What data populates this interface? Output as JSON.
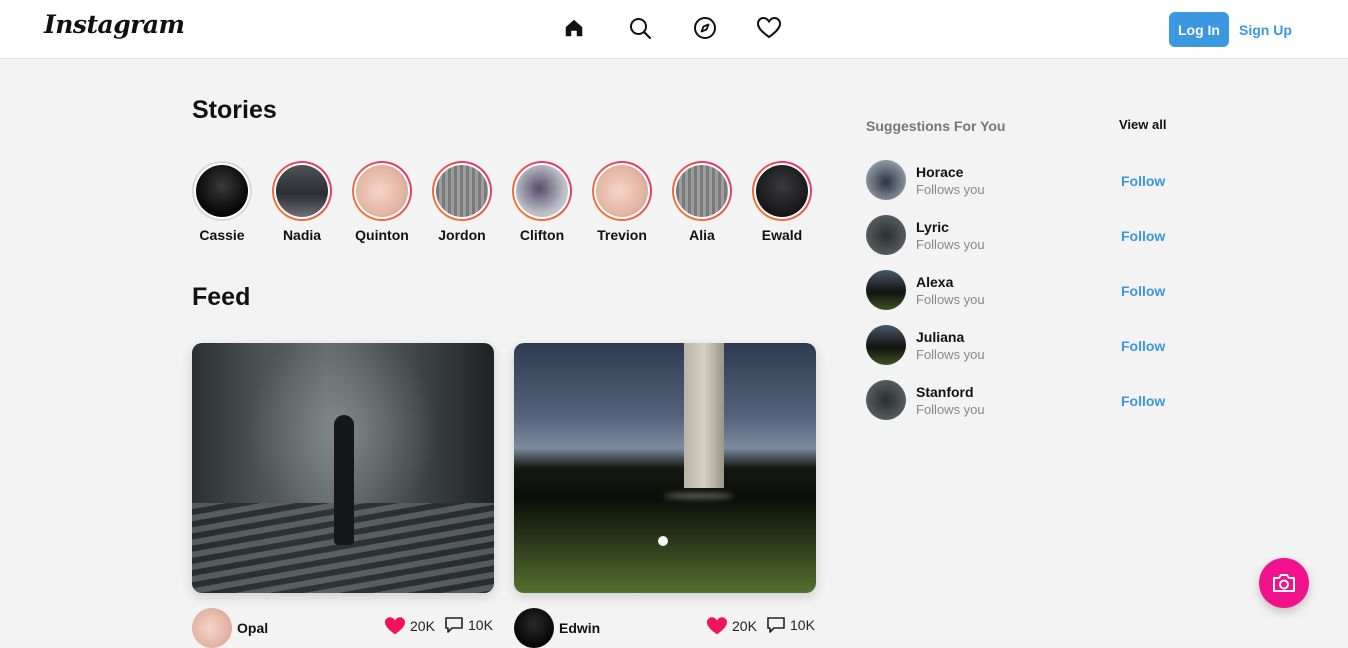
{
  "header": {
    "logo": "Instagram",
    "nav_icons": [
      "home-icon",
      "search-icon",
      "compass-icon",
      "heart-icon"
    ],
    "login_label": "Log In",
    "signup_label": "Sign Up"
  },
  "stories": {
    "title": "Stories",
    "items": [
      {
        "name": "Cassie",
        "seen": true
      },
      {
        "name": "Nadia",
        "seen": false
      },
      {
        "name": "Quinton",
        "seen": false
      },
      {
        "name": "Jordon",
        "seen": false
      },
      {
        "name": "Clifton",
        "seen": false
      },
      {
        "name": "Trevion",
        "seen": false
      },
      {
        "name": "Alia",
        "seen": false
      },
      {
        "name": "Ewald",
        "seen": false
      }
    ]
  },
  "feed": {
    "title": "Feed",
    "posts": [
      {
        "user": "Opal",
        "likes": "20K",
        "comments": "10K"
      },
      {
        "user": "Edwin",
        "likes": "20K",
        "comments": "10K"
      }
    ]
  },
  "suggestions": {
    "title": "Suggestions For You",
    "view_all": "View all",
    "items": [
      {
        "name": "Horace",
        "subtitle": "Follows you",
        "action": "Follow"
      },
      {
        "name": "Lyric",
        "subtitle": "Follows you",
        "action": "Follow"
      },
      {
        "name": "Alexa",
        "subtitle": "Follows you",
        "action": "Follow"
      },
      {
        "name": "Juliana",
        "subtitle": "Follows you",
        "action": "Follow"
      },
      {
        "name": "Stanford",
        "subtitle": "Follows you",
        "action": "Follow"
      }
    ]
  },
  "fab": {
    "icon": "camera-icon"
  },
  "colors": {
    "accent": "#3a97e0",
    "like": "#f0125e",
    "fab": "#f0128a"
  }
}
